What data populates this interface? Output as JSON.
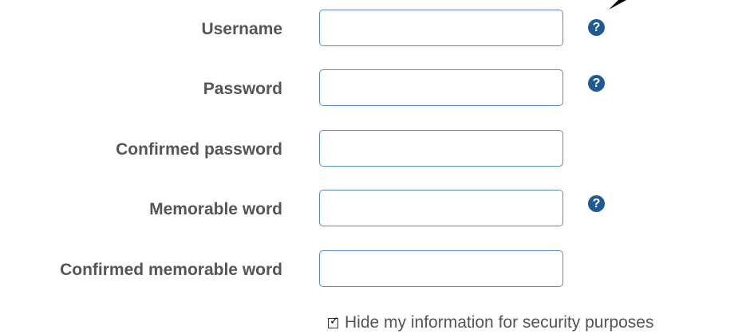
{
  "form": {
    "fields": [
      {
        "label": "Username",
        "value": "",
        "has_help": true
      },
      {
        "label": "Password",
        "value": "",
        "has_help": true
      },
      {
        "label": "Confirmed password",
        "value": "",
        "has_help": false
      },
      {
        "label": "Memorable word",
        "value": "",
        "has_help": true
      },
      {
        "label": "Confirmed memorable word",
        "value": "",
        "has_help": false
      }
    ],
    "help_glyph": "?",
    "hide_info": {
      "label": "Hide my information for security purposes",
      "checked": true,
      "check_glyph": "✓"
    }
  },
  "colors": {
    "label_text": "#555555",
    "field_border": "#5b8bc4",
    "help_icon_bg": "#1e5a93"
  },
  "icons": {
    "help": "question-circle-icon",
    "corner": "cursor-arrow-icon"
  }
}
